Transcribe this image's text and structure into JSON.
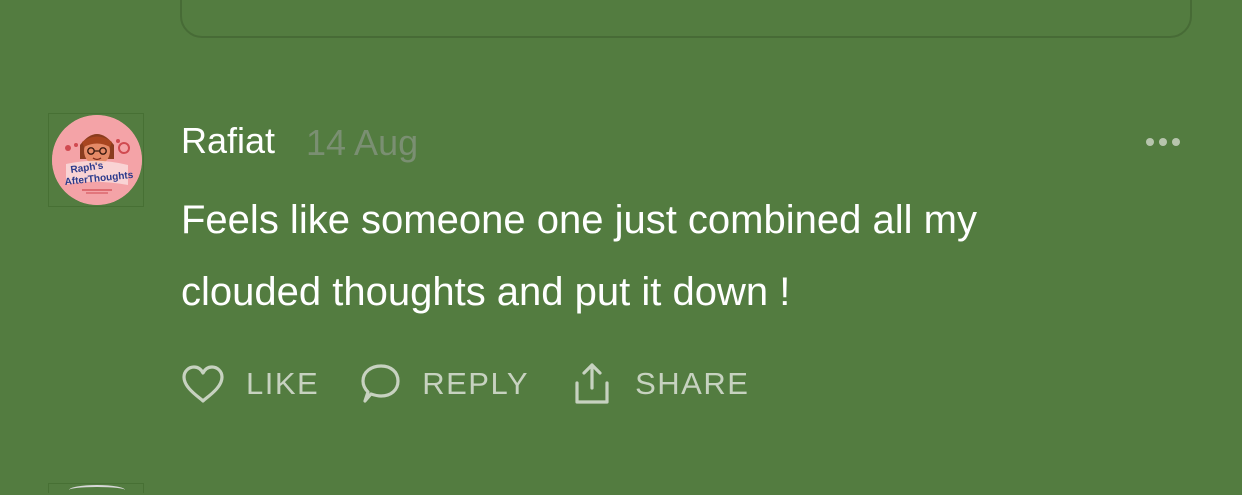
{
  "comment": {
    "author": "Rafiat",
    "date": "14 Aug",
    "text_lines": [
      "Feels like someone one just combined all my",
      "clouded thoughts and put it down !"
    ],
    "avatar": {
      "icon": "avatar-logo-icon",
      "logo_text": "Raph's AfterThoughts",
      "logo_line1": "Raph's",
      "logo_line2": "AfterThoughts"
    }
  },
  "actions": {
    "like": {
      "label": "LIKE",
      "icon": "heart-icon"
    },
    "reply": {
      "label": "REPLY",
      "icon": "speech-bubble-icon"
    },
    "share": {
      "label": "SHARE",
      "icon": "share-icon"
    }
  },
  "menu": {
    "icon": "more-options-icon"
  },
  "colors": {
    "background": "#537c40",
    "text": "#ffffff",
    "muted_text": "#7a8f72",
    "action_text": "#c7d2c0",
    "avatar_bg": "#f4a3a7"
  }
}
